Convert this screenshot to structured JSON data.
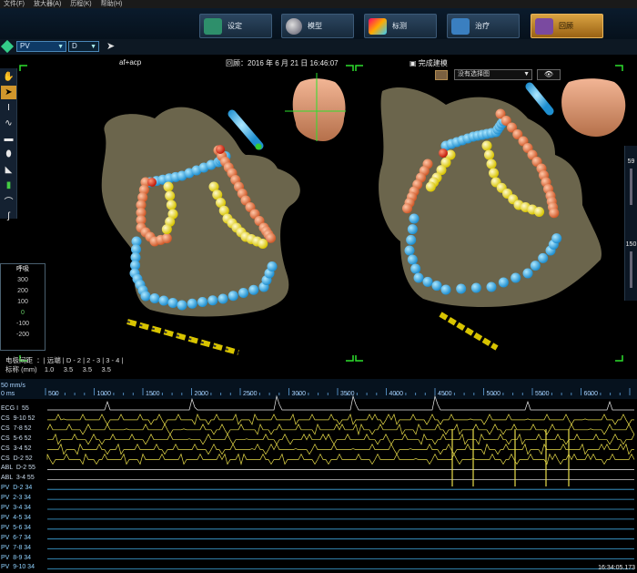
{
  "menu": [
    "文件(F)",
    "放大器(A)",
    "历程(K)",
    "帮助(H)"
  ],
  "nav": [
    {
      "label": "设定",
      "icon": "config-icon",
      "color": "#2e8f6b"
    },
    {
      "label": "模型",
      "icon": "sphere-icon",
      "color": "#8a9aa8"
    },
    {
      "label": "标测",
      "icon": "mapping-icon",
      "color": "#c24bc8"
    },
    {
      "label": "治疗",
      "icon": "ablation-icon",
      "color": "#3a7fc0"
    },
    {
      "label": "回顾",
      "icon": "review-icon",
      "color": "#7a4aa0",
      "active": true
    }
  ],
  "subbar": {
    "catheter": "PV",
    "electrode": "D"
  },
  "viewer": {
    "left_title": "af+acp",
    "review_time": "回顾：2016 年 6 月 21 日 16:46:07",
    "complete": "完成建模",
    "map_select": "没有选择图",
    "slider_value": "59",
    "slider_value2": "150"
  },
  "respiration": {
    "title": "呼吸",
    "ticks": [
      "300",
      "200",
      "100",
      "0",
      "-100",
      "-200",
      "-300%"
    ]
  },
  "electrodes": {
    "line1": "电极间距  ：| 远端 | D - 2 | 2 - 3 | 3 - 4 |",
    "line2": "标称 (mm)    1.0     3.5     3.5     3.5"
  },
  "ecg": {
    "speed": "50 mm/s",
    "zero": "0 ms",
    "ruler": [
      "500",
      "1000",
      "1500",
      "2000",
      "2500",
      "3000",
      "3500",
      "4000",
      "4500",
      "5000",
      "5500",
      "6000"
    ],
    "channels": [
      {
        "label": "ECG I  55",
        "type": "ecg"
      },
      {
        "label": "CS  9-10 52",
        "type": "cs"
      },
      {
        "label": "CS  7-8 52",
        "type": "cs"
      },
      {
        "label": "CS  5-6 52",
        "type": "cs"
      },
      {
        "label": "CS  3-4 52",
        "type": "cs"
      },
      {
        "label": "CS  D-2 52",
        "type": "cs"
      },
      {
        "label": "ABL  D-2 55",
        "type": "abl"
      },
      {
        "label": "ABL  3-4 55",
        "type": "abl"
      },
      {
        "label": "PV  D-2 34",
        "type": "pv"
      },
      {
        "label": "PV  2-3 34",
        "type": "pv"
      },
      {
        "label": "PV  3-4 34",
        "type": "pv"
      },
      {
        "label": "PV  4-5 34",
        "type": "pv"
      },
      {
        "label": "PV  5-6 34",
        "type": "pv"
      },
      {
        "label": "PV  6-7 34",
        "type": "pv"
      },
      {
        "label": "PV  7-8 34",
        "type": "pv"
      },
      {
        "label": "PV  8-9 34",
        "type": "pv"
      },
      {
        "label": "PV  9-10 34",
        "type": "pv"
      }
    ],
    "clock": "16:34:05.173"
  }
}
